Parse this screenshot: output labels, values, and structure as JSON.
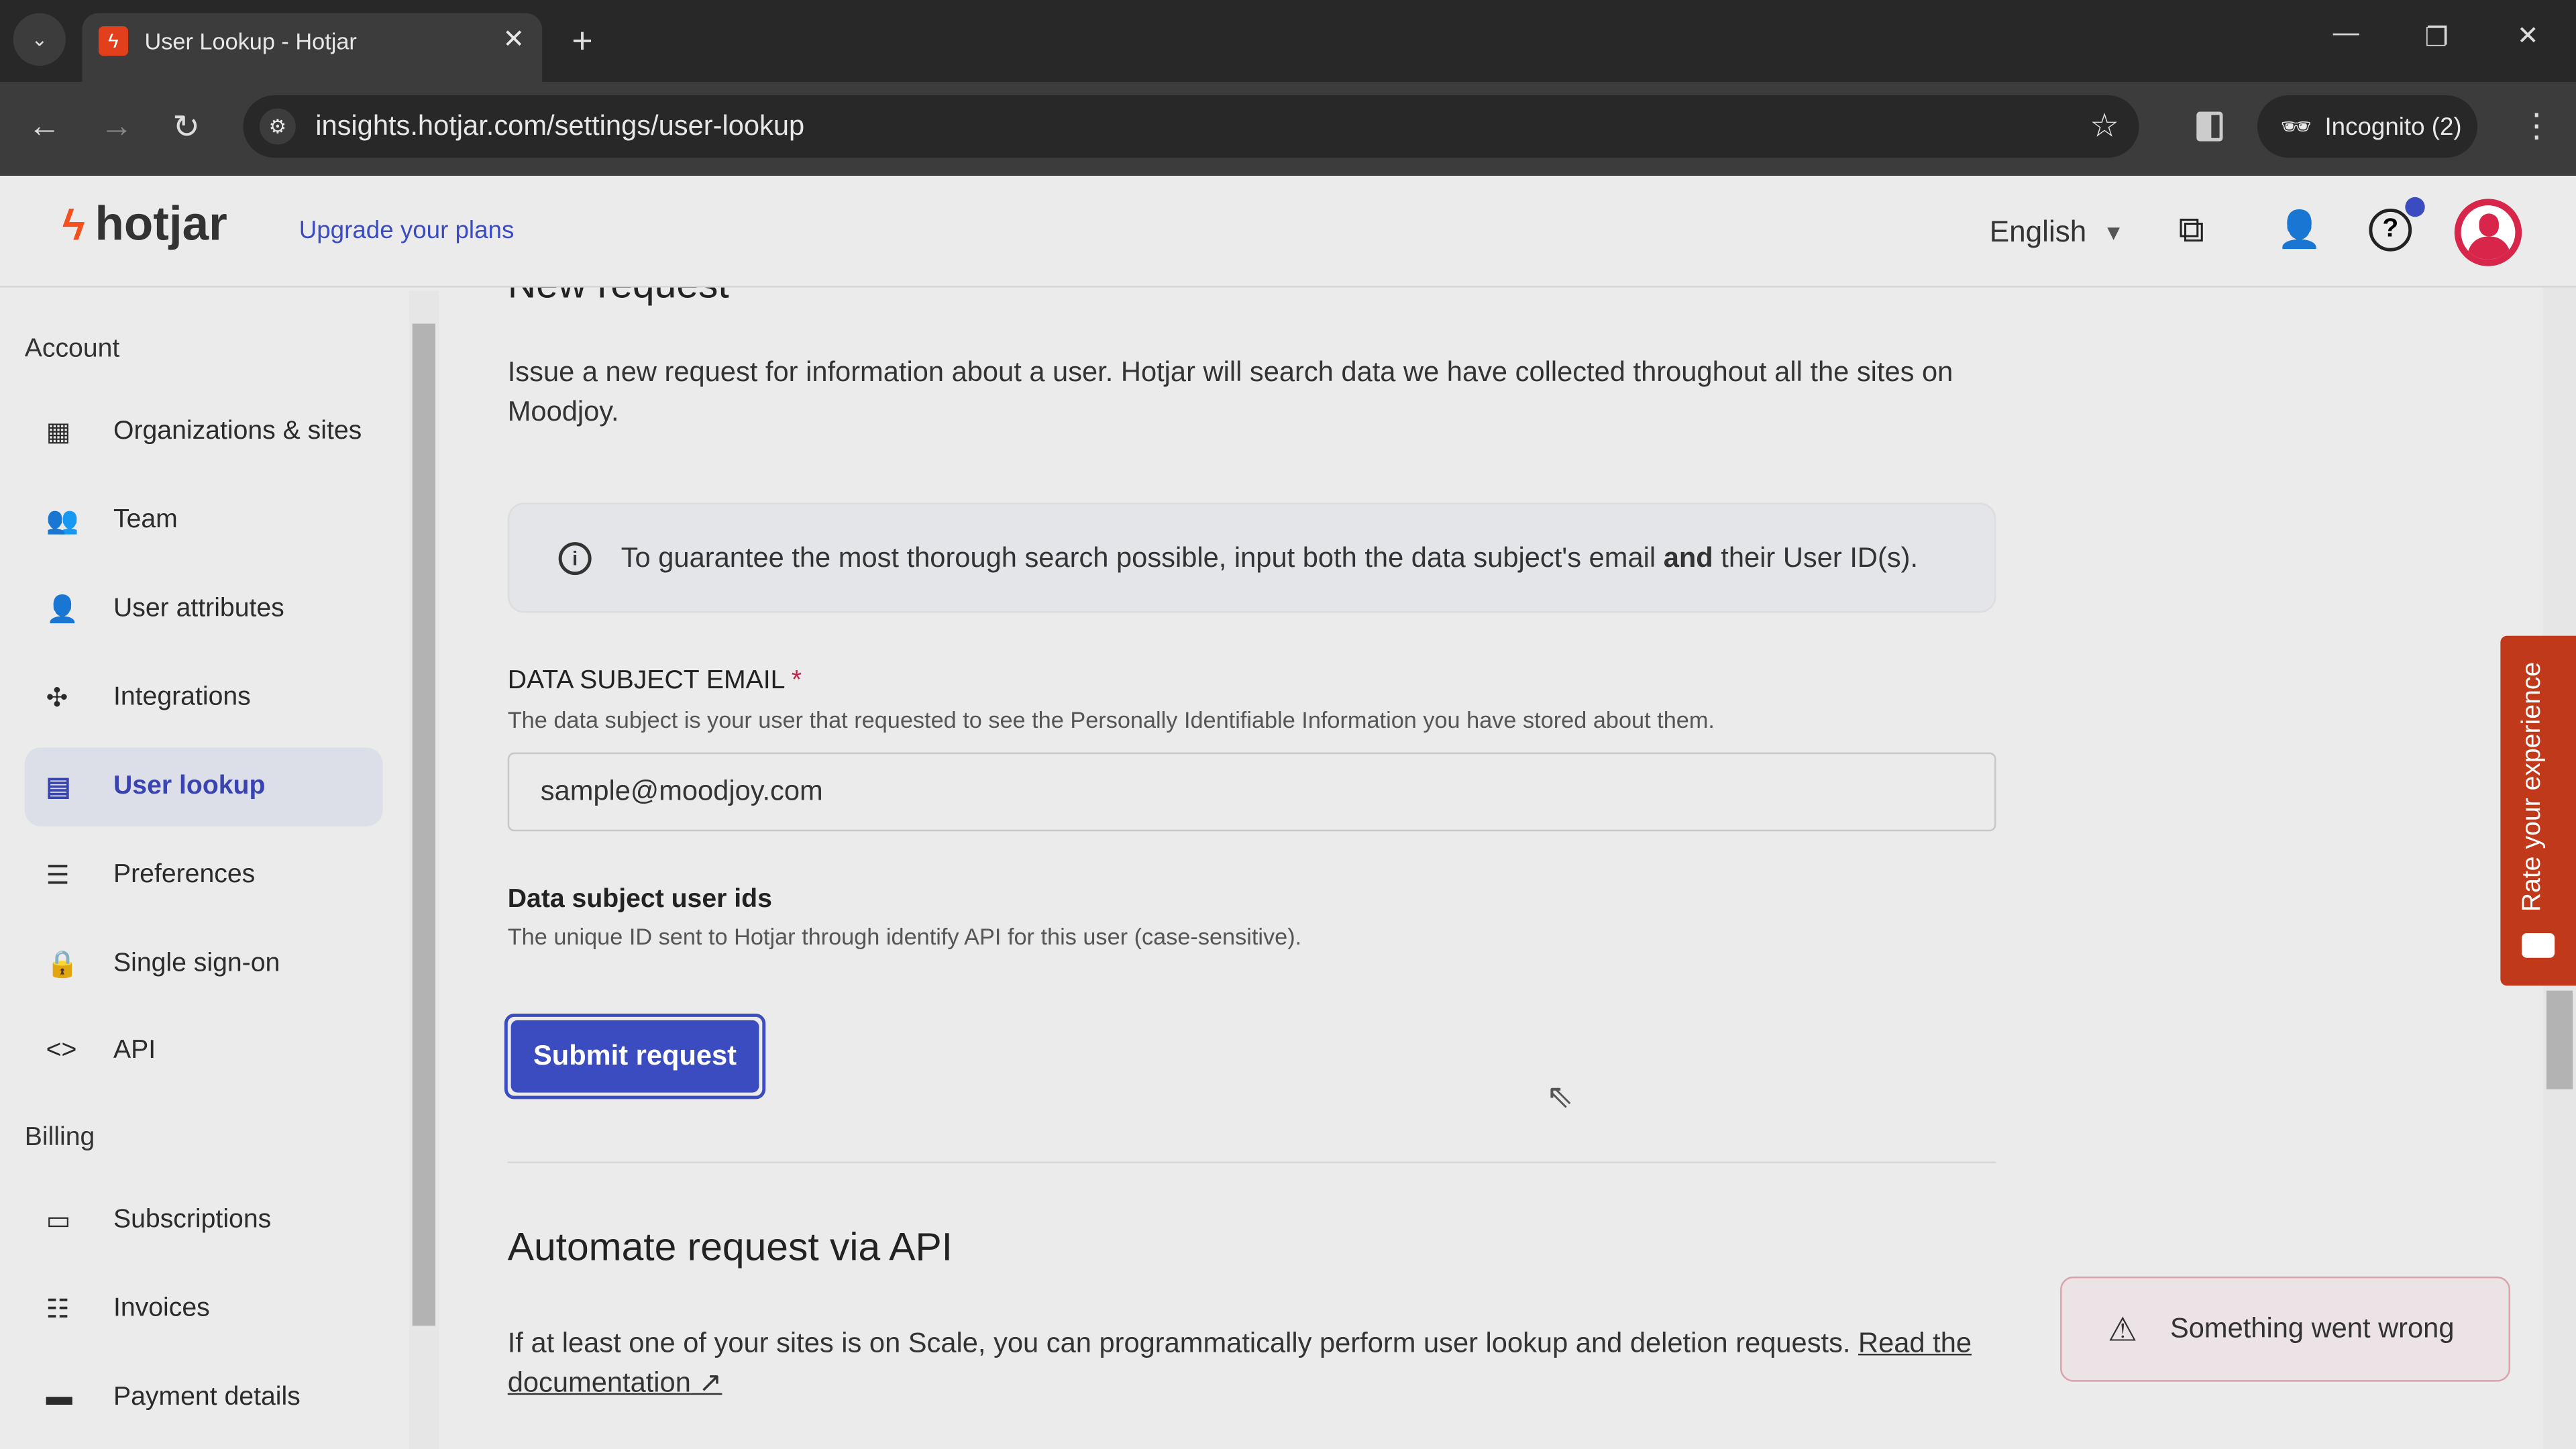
{
  "browser": {
    "tab_title": "User Lookup - Hotjar",
    "url": "insights.hotjar.com/settings/user-lookup",
    "incognito_label": "Incognito (2)"
  },
  "header": {
    "logo_text": "hotjar",
    "upgrade_link": "Upgrade your plans",
    "language": "English",
    "notification_color": "#3b4cc0",
    "avatar_color": "#d7264a"
  },
  "sidebar": {
    "sections": [
      {
        "title": "Account",
        "items": [
          {
            "label": "Organizations & sites",
            "icon": "building-icon"
          },
          {
            "label": "Team",
            "icon": "team-icon"
          },
          {
            "label": "User attributes",
            "icon": "user-attributes-icon"
          },
          {
            "label": "Integrations",
            "icon": "puzzle-icon"
          },
          {
            "label": "User lookup",
            "icon": "user-lookup-icon",
            "active": true
          },
          {
            "label": "Preferences",
            "icon": "sliders-icon"
          },
          {
            "label": "Single sign-on",
            "icon": "lock-icon"
          },
          {
            "label": "API",
            "icon": "code-icon"
          }
        ]
      },
      {
        "title": "Billing",
        "items": [
          {
            "label": "Subscriptions",
            "icon": "subscriptions-icon"
          },
          {
            "label": "Invoices",
            "icon": "invoice-icon"
          },
          {
            "label": "Payment details",
            "icon": "credit-card-icon"
          }
        ]
      }
    ]
  },
  "main": {
    "heading": "New request",
    "intro": "Issue a new request for information about a user. Hotjar will search data we have collected throughout all the sites on Moodjoy.",
    "info_pre": "To guarantee the most thorough search possible, input both the data subject's email ",
    "info_bold": "and",
    "info_post": " their User ID(s).",
    "email_label": "DATA SUBJECT EMAIL",
    "email_required": "*",
    "email_help": "The data subject is your user that requested to see the Personally Identifiable Information you have stored about them.",
    "email_value": "sample@moodjoy.com",
    "ids_label": "Data subject user ids",
    "ids_help": "The unique ID sent to Hotjar through identify API for this user (case-sensitive).",
    "submit_label": "Submit request",
    "api_heading": "Automate request via API",
    "api_text": "If at least one of your sites is on Scale, you can programmatically perform user lookup and deletion requests. ",
    "api_link": "Read the documentation"
  },
  "toast": {
    "message": "Something went wrong"
  },
  "feedback_tab": {
    "label": "Rate your experience",
    "color": "#c0391b"
  },
  "colors": {
    "accent": "#3b4cc0",
    "brand": "#f4511e"
  }
}
